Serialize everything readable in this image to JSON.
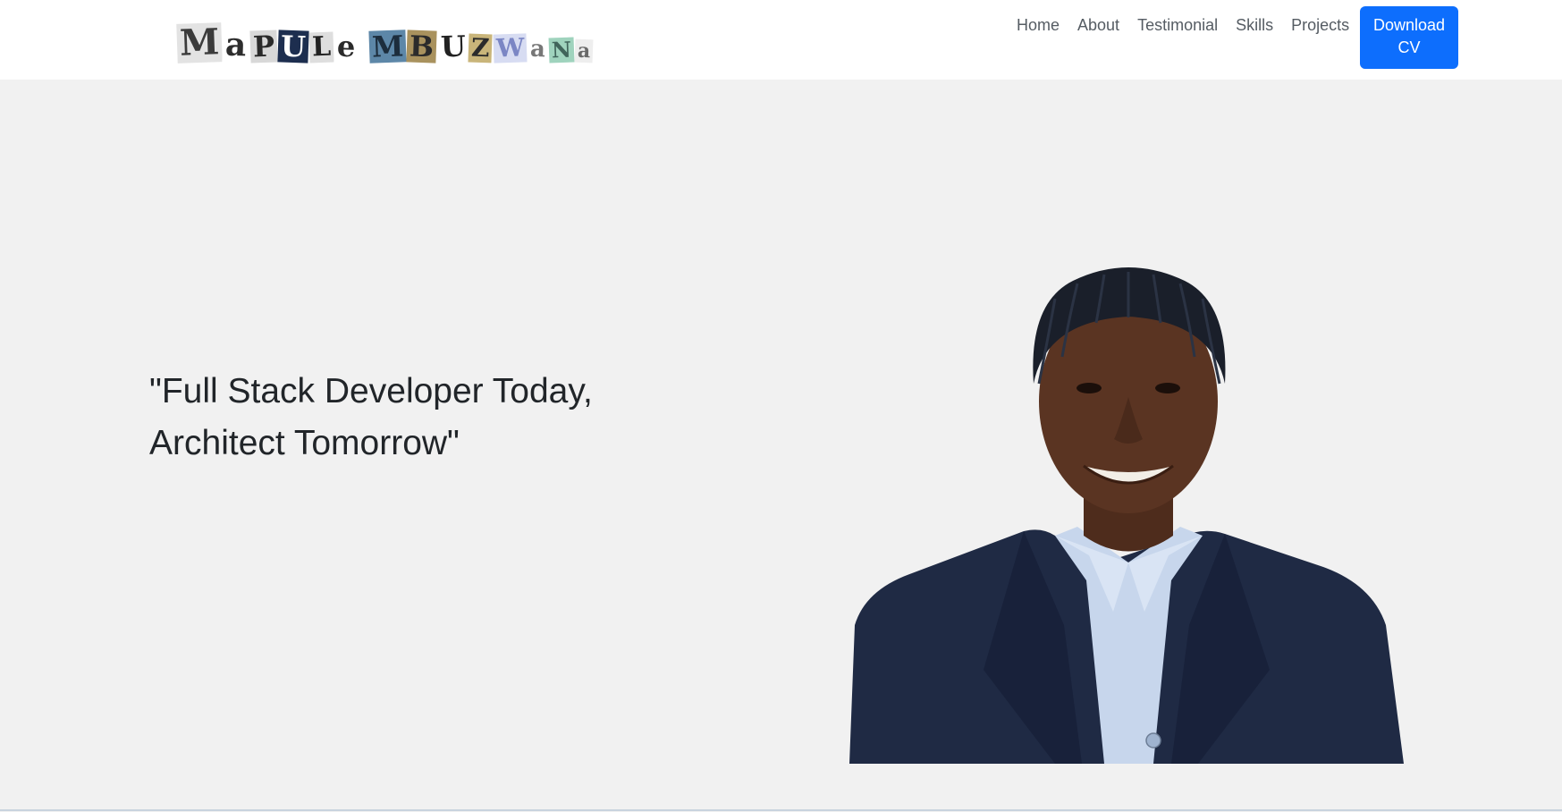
{
  "logo": {
    "text": "MaPULe MBUZWaNa",
    "letters_first": [
      {
        "c": "M",
        "bg": "#e3e3e3",
        "fg": "#3b3b3b",
        "size": 40
      },
      {
        "c": "a",
        "bg": "#ffffff",
        "fg": "#2d2d2d",
        "size": 36
      },
      {
        "c": "P",
        "bg": "#d8d8d8",
        "fg": "#2a2a2a",
        "size": 32
      },
      {
        "c": "U",
        "bg": "#1d2e4f",
        "fg": "#ffffff",
        "size": 32
      },
      {
        "c": "L",
        "bg": "#dedede",
        "fg": "#222222",
        "size": 30
      },
      {
        "c": "e",
        "bg": "#ffffff",
        "fg": "#2a2a2a",
        "size": 32
      }
    ],
    "letters_last": [
      {
        "c": "M",
        "bg": "#5d87a8",
        "fg": "#1c2d3d",
        "size": 32
      },
      {
        "c": "B",
        "bg": "#a9925e",
        "fg": "#2b2b2b",
        "size": 32
      },
      {
        "c": "U",
        "bg": "#ffffff",
        "fg": "#222222",
        "size": 32
      },
      {
        "c": "Z",
        "bg": "#c9b57a",
        "fg": "#2b2b2b",
        "size": 28
      },
      {
        "c": "W",
        "bg": "#d7dcf2",
        "fg": "#7b86c4",
        "size": 28
      },
      {
        "c": "a",
        "bg": "#ffffff",
        "fg": "#777777",
        "size": 26
      },
      {
        "c": "N",
        "bg": "#9fd3bd",
        "fg": "#40645a",
        "size": 24
      },
      {
        "c": "a",
        "bg": "#eeeeee",
        "fg": "#6a6a6a",
        "size": 22
      }
    ]
  },
  "nav": {
    "items": [
      "Home",
      "About",
      "Testimonial",
      "Skills",
      "Projects"
    ],
    "download_cv": "Download CV"
  },
  "hero": {
    "tagline": "\"Full Stack Developer Today, Architect Tomorrow\""
  },
  "colors": {
    "accent": "#0d6efd",
    "hero_bg": "#f1f1f1",
    "navbar_bg": "#ffffff",
    "jacket": "#1f2a44",
    "shirt": "#c7d6ec",
    "skin": "#5a3422",
    "hair": "#1a1f2a"
  }
}
